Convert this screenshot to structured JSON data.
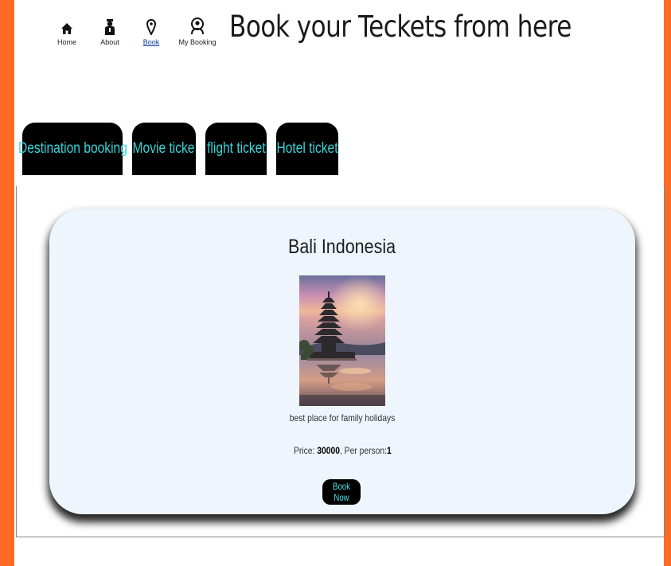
{
  "nav": {
    "items": [
      {
        "label": "Home",
        "icon": "home-icon",
        "active": false
      },
      {
        "label": "About",
        "icon": "person-icon",
        "active": false
      },
      {
        "label": "Book",
        "icon": "location-pin-icon",
        "active": true
      },
      {
        "label": "My Booking",
        "icon": "user-circle-icon",
        "active": false
      }
    ]
  },
  "page_title": "Book your Teckets from here",
  "tabs": [
    {
      "label": "Destination booking"
    },
    {
      "label": "Movie ticke"
    },
    {
      "label": "flight ticket"
    },
    {
      "label": "Hotel ticket"
    }
  ],
  "card": {
    "title": "Bali Indonesia",
    "image_alt": "temple-on-lake-photo",
    "description": "best place for family holidays",
    "price_label": "Price: ",
    "price_value": "30000",
    "per_person_label": ", Per person:",
    "per_person_value": "1",
    "book_button": "Book Now"
  },
  "colors": {
    "border_orange": "#ff6a26",
    "tab_bg": "#000000",
    "tab_text": "#36d6dc",
    "card_bg": "#eef5fd"
  }
}
